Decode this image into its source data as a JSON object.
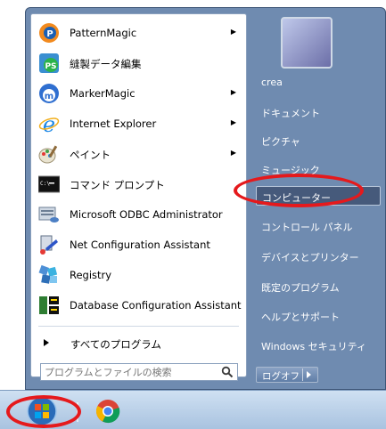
{
  "programs": [
    {
      "label": "PatternMagic",
      "icon": "patternmagic-icon",
      "has_submenu": true
    },
    {
      "label": "縫製データ編集",
      "icon": "ps-data-edit-icon",
      "has_submenu": false
    },
    {
      "label": "MarkerMagic",
      "icon": "markermagic-icon",
      "has_submenu": true
    },
    {
      "label": "Internet Explorer",
      "icon": "internet-explorer-icon",
      "has_submenu": true
    },
    {
      "label": "ペイント",
      "icon": "paint-icon",
      "has_submenu": true
    },
    {
      "label": "コマンド プロンプト",
      "icon": "command-prompt-icon",
      "has_submenu": false
    },
    {
      "label": "Microsoft ODBC Administrator",
      "icon": "odbc-icon",
      "has_submenu": false
    },
    {
      "label": "Net Configuration Assistant",
      "icon": "net-config-icon",
      "has_submenu": false
    },
    {
      "label": "Registry",
      "icon": "registry-icon",
      "has_submenu": false
    },
    {
      "label": "Database Configuration Assistant",
      "icon": "db-config-icon",
      "has_submenu": false
    }
  ],
  "all_programs": "すべてのプログラム",
  "search": {
    "placeholder": "プログラムとファイルの検索"
  },
  "right_links": [
    {
      "label": "crea"
    },
    {
      "label": "ドキュメント"
    },
    {
      "label": "ピクチャ"
    },
    {
      "label": "ミュージック"
    },
    {
      "label": "コンピューター",
      "highlighted": true
    },
    {
      "label": "コントロール パネル"
    },
    {
      "label": "デバイスとプリンター"
    },
    {
      "label": "既定のプログラム"
    },
    {
      "label": "ヘルプとサポート"
    },
    {
      "label": "Windows セキュリティ"
    }
  ],
  "logoff_label": "ログオフ",
  "colors": {
    "menu_frame": "#6f8bb0",
    "annotation": "#e5191c",
    "taskbar": "#bcd2ea"
  },
  "annotations": [
    "コンピューター",
    "start-button"
  ]
}
